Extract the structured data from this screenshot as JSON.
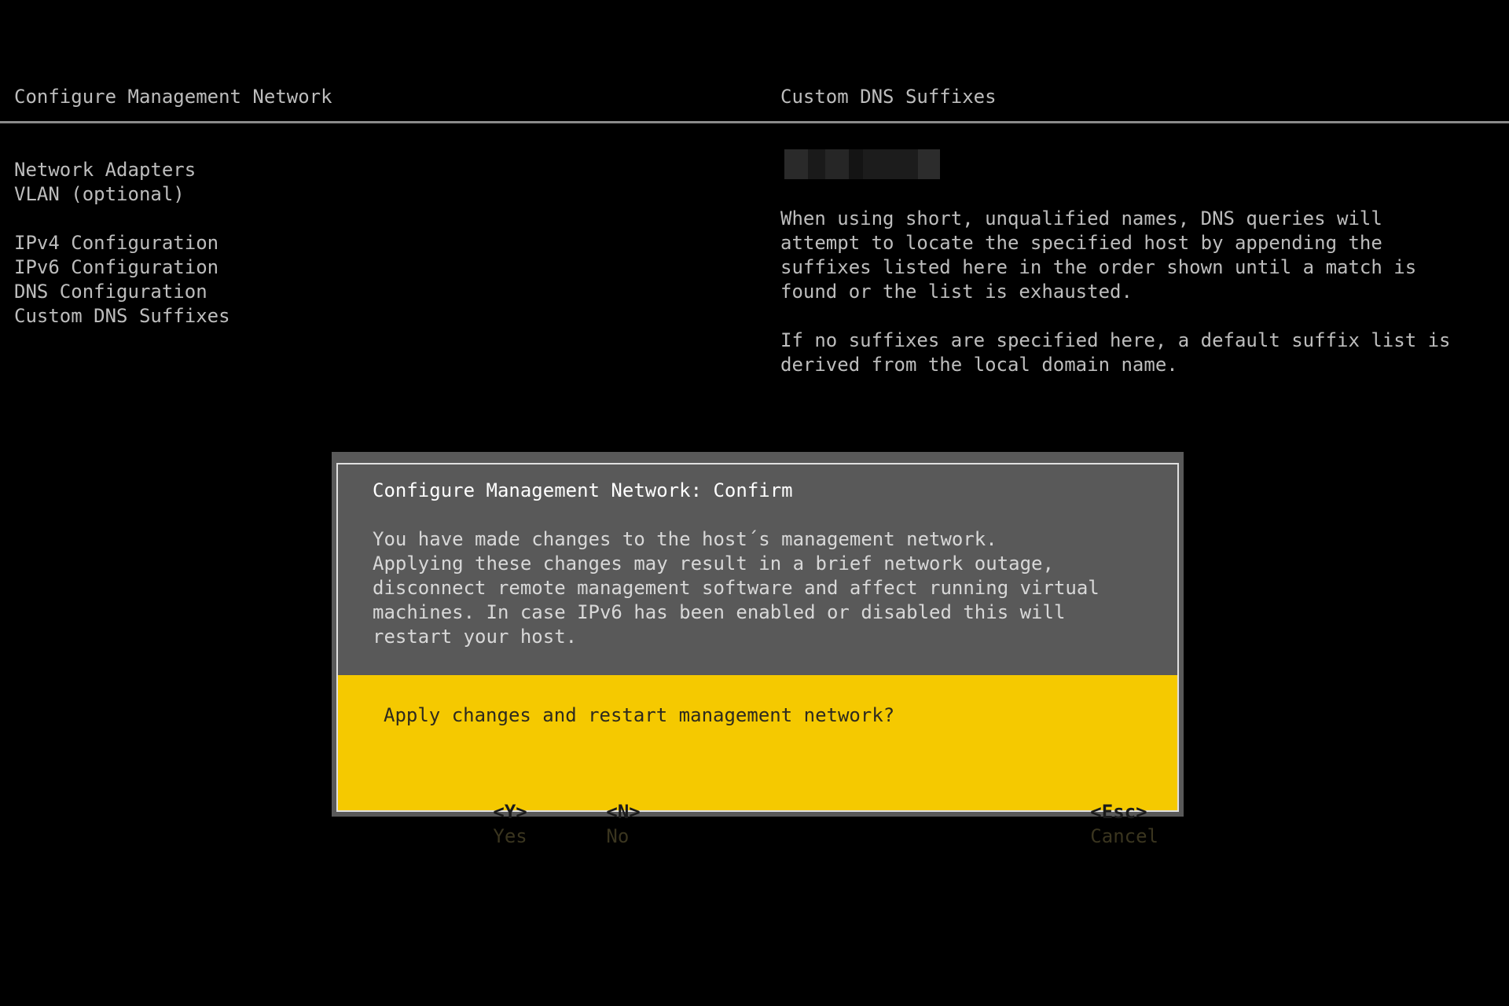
{
  "header": {
    "left_title": "Configure Management Network",
    "right_title": "Custom DNS Suffixes"
  },
  "menu": {
    "items": [
      {
        "label": "Network Adapters"
      },
      {
        "label": "VLAN (optional)"
      },
      {
        "label": "IPv4 Configuration"
      },
      {
        "label": "IPv6 Configuration"
      },
      {
        "label": "DNS Configuration"
      },
      {
        "label": "Custom DNS Suffixes"
      }
    ]
  },
  "detail": {
    "paragraph1": "When using short, unqualified names, DNS queries will\nattempt to locate the specified host by appending the\nsuffixes listed here in the order shown until a match is\nfound or the list is exhausted.",
    "paragraph2": "If no suffixes are specified here, a default suffix list is\nderived from the local domain name."
  },
  "dialog": {
    "title": "Configure Management Network: Confirm",
    "message": "You have made changes to the host´s management network.\nApplying these changes may result in a brief network outage,\ndisconnect remote management software and affect running virtual\nmachines. In case IPv6 has been enabled or disabled this will\nrestart your host.",
    "question": "Apply changes and restart management network?",
    "actions": {
      "yes_key": "<Y>",
      "yes_label": "Yes",
      "no_key": "<N>",
      "no_label": "No",
      "cancel_key": "<Esc>",
      "cancel_label": "Cancel"
    }
  },
  "colors": {
    "background": "#000000",
    "text": "#bdbdbd",
    "dialog_gray": "#595959",
    "dialog_yellow": "#f5c900"
  }
}
